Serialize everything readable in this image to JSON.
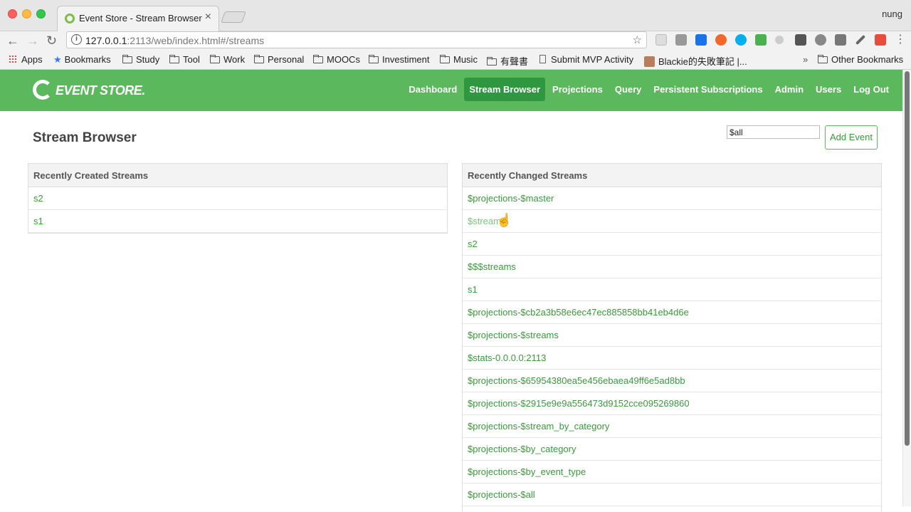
{
  "browser": {
    "tab_title": "Event Store - Stream Browser",
    "tab_close": "×",
    "profile_name": "nung",
    "nav_back": "←",
    "nav_forward": "→",
    "nav_reload": "↻",
    "url_host": "127.0.0.1",
    "url_rest": ":2113/web/index.html#/streams",
    "info_glyph": "i",
    "star_glyph": "☆"
  },
  "bookmarks": {
    "items": [
      {
        "label": "Apps",
        "type": "apps"
      },
      {
        "label": "Bookmarks",
        "type": "star"
      },
      {
        "label": "Study",
        "type": "folder"
      },
      {
        "label": "Tool",
        "type": "folder"
      },
      {
        "label": "Work",
        "type": "folder"
      },
      {
        "label": "Personal",
        "type": "folder"
      },
      {
        "label": "MOOCs",
        "type": "folder"
      },
      {
        "label": "Investiment",
        "type": "folder"
      },
      {
        "label": "Music",
        "type": "folder"
      },
      {
        "label": "有聲書",
        "type": "folder"
      },
      {
        "label": "Submit MVP Activity",
        "type": "page"
      },
      {
        "label": "Blackie的失敗筆記 |...",
        "type": "avatar"
      }
    ],
    "overflow": "»",
    "other": "Other Bookmarks"
  },
  "app": {
    "logo_text": "EVENT STORE.",
    "nav": [
      {
        "label": "Dashboard",
        "active": false
      },
      {
        "label": "Stream Browser",
        "active": true
      },
      {
        "label": "Projections",
        "active": false
      },
      {
        "label": "Query",
        "active": false
      },
      {
        "label": "Persistent Subscriptions",
        "active": false
      },
      {
        "label": "Admin",
        "active": false
      },
      {
        "label": "Users",
        "active": false
      },
      {
        "label": "Log Out",
        "active": false
      }
    ],
    "accent_color": "#5cb85c"
  },
  "page": {
    "title": "Stream Browser",
    "filter_value": "$all",
    "add_event_label": "Add Event"
  },
  "recently_created": {
    "heading": "Recently Created Streams",
    "streams": [
      "s2",
      "s1"
    ]
  },
  "recently_changed": {
    "heading": "Recently Changed Streams",
    "streams": [
      "$projections-$master",
      "$streams",
      "s2",
      "$$$streams",
      "s1",
      "$projections-$cb2a3b58e6ec47ec885858bb41eb4d6e",
      "$projections-$streams",
      "$stats-0.0.0.0:2113",
      "$projections-$65954380ea5e456ebaea49ff6e5ad8bb",
      "$projections-$2915e9e9a556473d9152cce095269860",
      "$projections-$stream_by_category",
      "$projections-$by_category",
      "$projections-$by_event_type",
      "$projections-$all"
    ],
    "hovered_index": 1
  }
}
